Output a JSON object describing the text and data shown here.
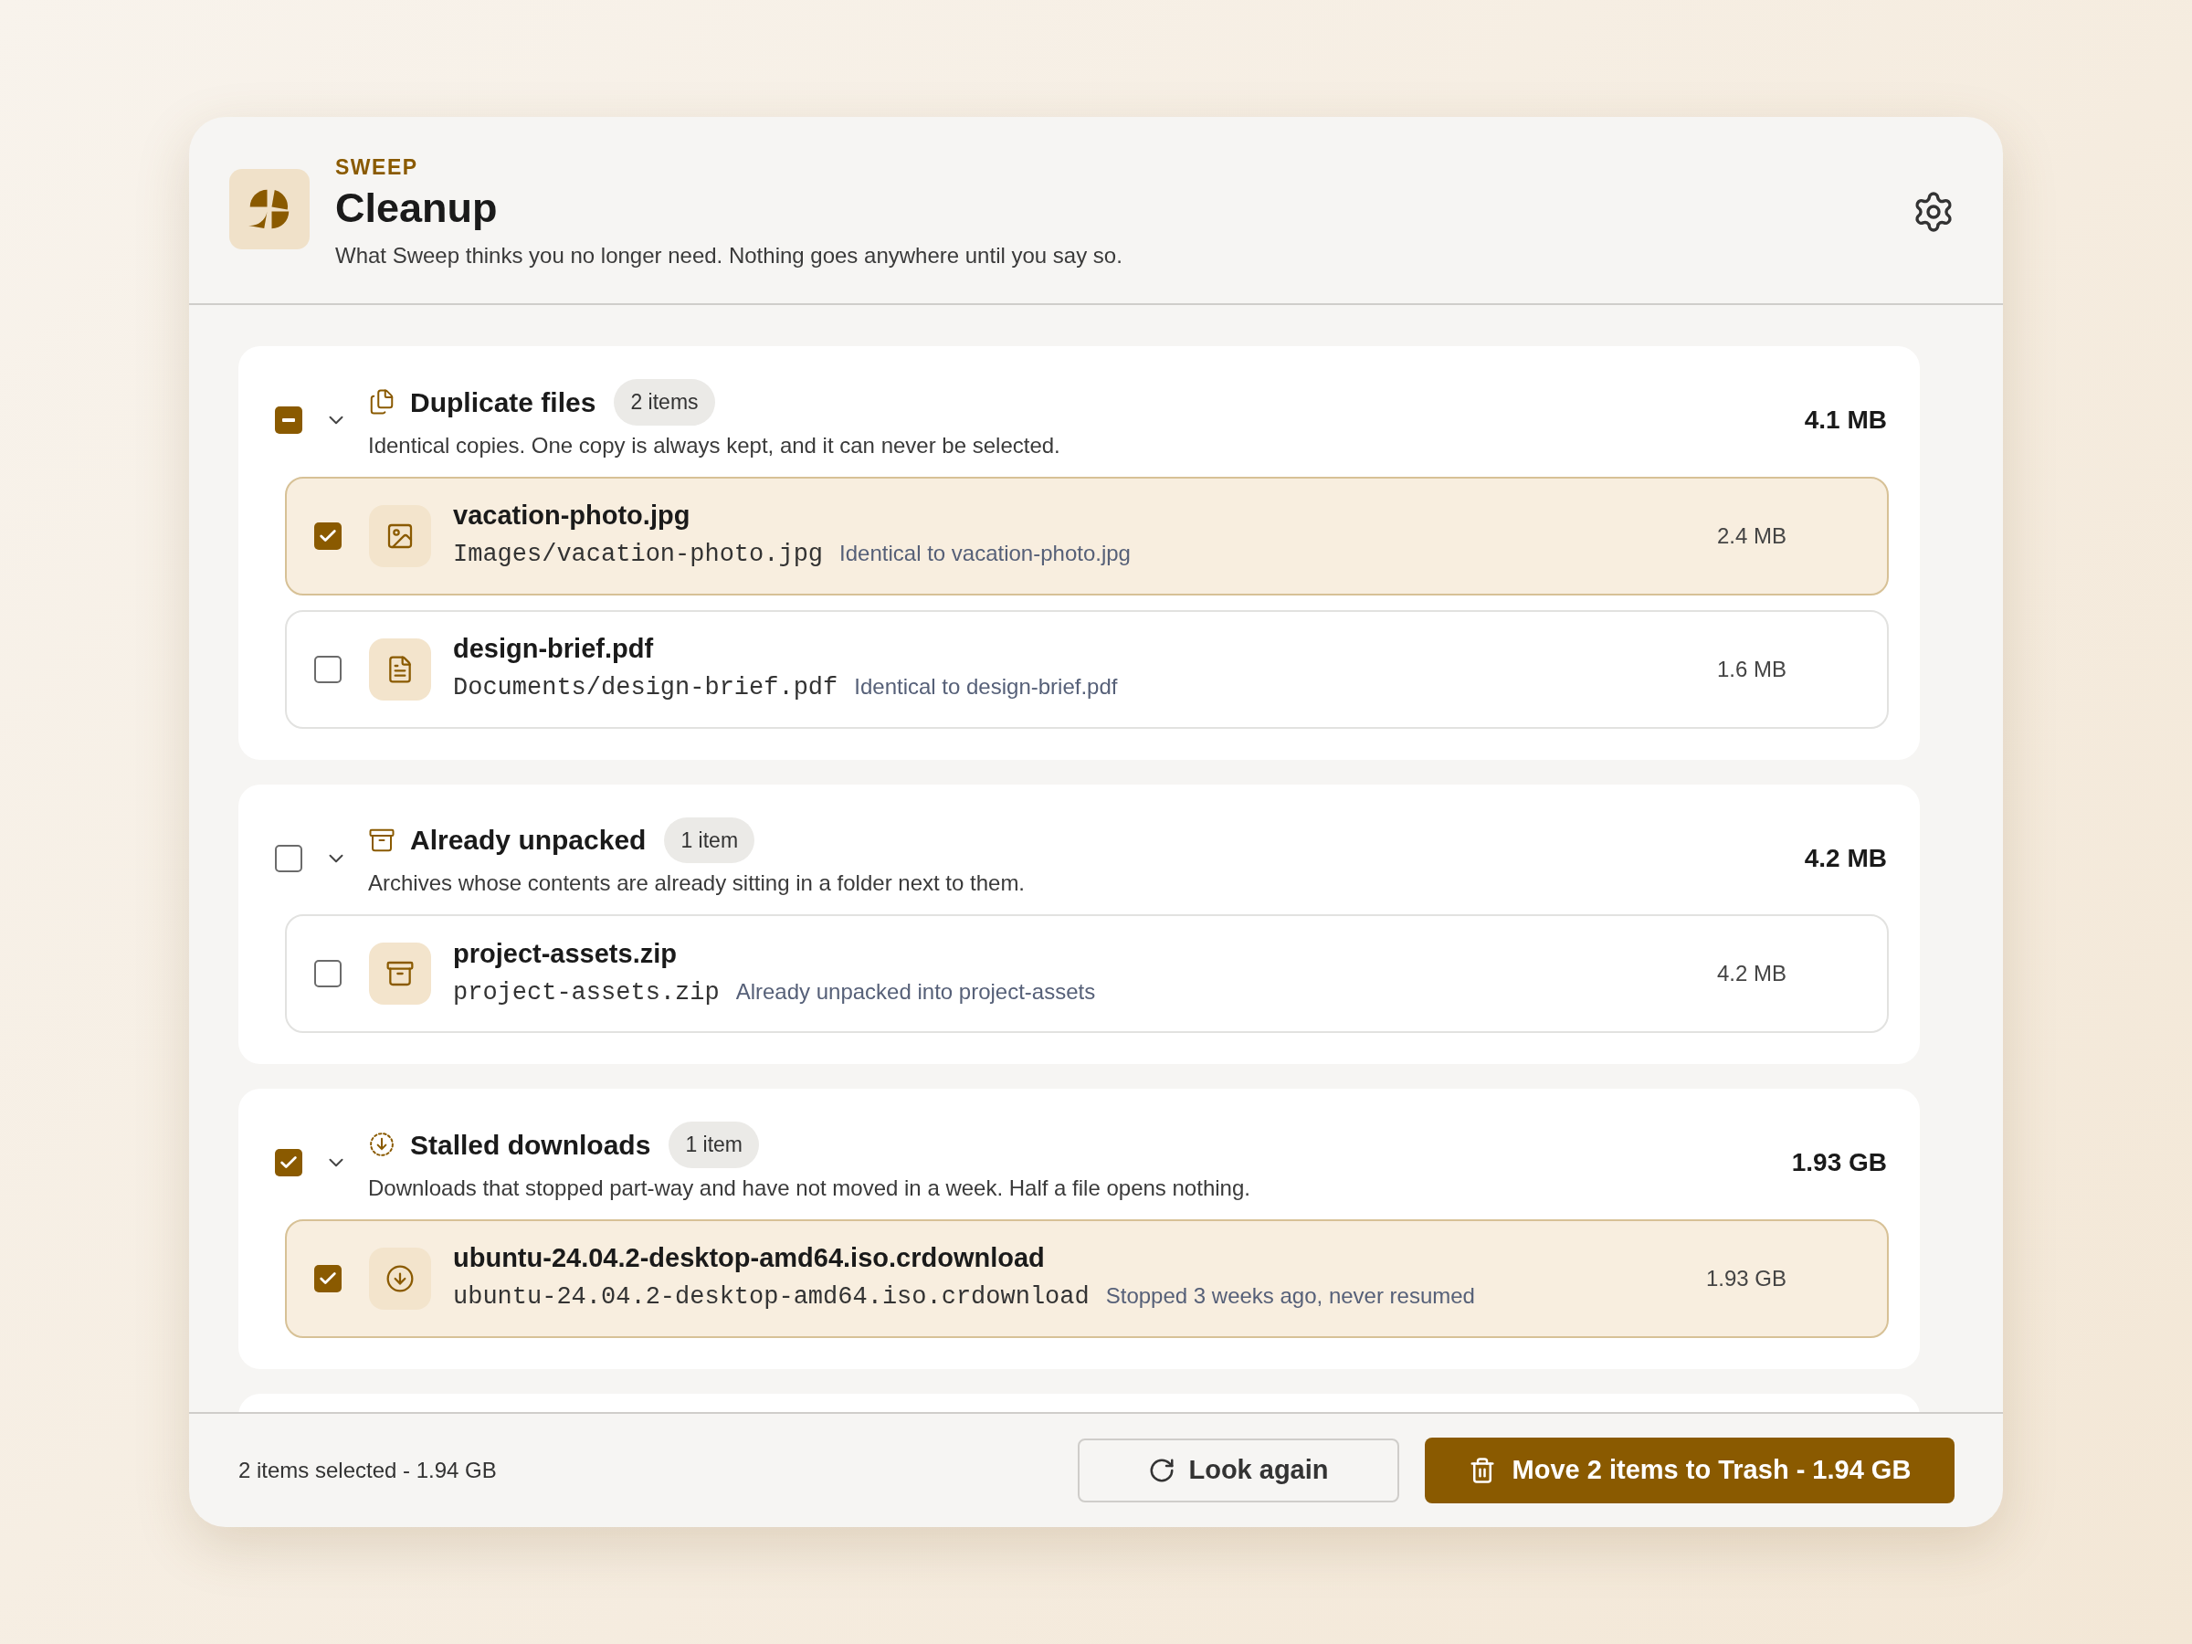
{
  "header": {
    "eyebrow": "SWEEP",
    "title": "Cleanup",
    "subtitle": "What Sweep thinks you no longer need. Nothing goes anywhere until you say so."
  },
  "groups": [
    {
      "kind": "copy",
      "title": "Duplicate files",
      "count": "2 items",
      "description": "Identical copies. One copy is always kept, and it can never be selected.",
      "size": "4.1 MB",
      "checked": false,
      "indeterminate": true,
      "expanded": true,
      "items": [
        {
          "kind": "image",
          "name": "vacation-photo.jpg",
          "path": "Images/vacation-photo.jpg",
          "note": "Identical to vacation-photo.jpg",
          "size": "2.4 MB",
          "checked": true
        },
        {
          "kind": "document",
          "name": "design-brief.pdf",
          "path": "Documents/design-brief.pdf",
          "note": "Identical to design-brief.pdf",
          "size": "1.6 MB",
          "checked": false
        }
      ]
    },
    {
      "kind": "archive",
      "title": "Already unpacked",
      "count": "1 item",
      "description": "Archives whose contents are already sitting in a folder next to them.",
      "size": "4.2 MB",
      "checked": false,
      "indeterminate": false,
      "expanded": true,
      "items": [
        {
          "kind": "archive",
          "name": "project-assets.zip",
          "path": "project-assets.zip",
          "note": "Already unpacked into project-assets",
          "size": "4.2 MB",
          "checked": false
        }
      ]
    },
    {
      "kind": "download",
      "title": "Stalled downloads",
      "count": "1 item",
      "description": "Downloads that stopped part-way and have not moved in a week. Half a file opens nothing.",
      "size": "1.93 GB",
      "checked": true,
      "indeterminate": false,
      "expanded": true,
      "items": [
        {
          "kind": "download",
          "name": "ubuntu-24.04.2-desktop-amd64.iso.crdownload",
          "path": "ubuntu-24.04.2-desktop-amd64.iso.crdownload",
          "note": "Stopped 3 weeks ago, never resumed",
          "size": "1.93 GB",
          "checked": true
        }
      ]
    }
  ],
  "footer": {
    "status": "2 items selected - 1.94 GB",
    "secondary_button": "Look again",
    "primary_button": "Move 2 items to Trash - 1.94 GB"
  }
}
